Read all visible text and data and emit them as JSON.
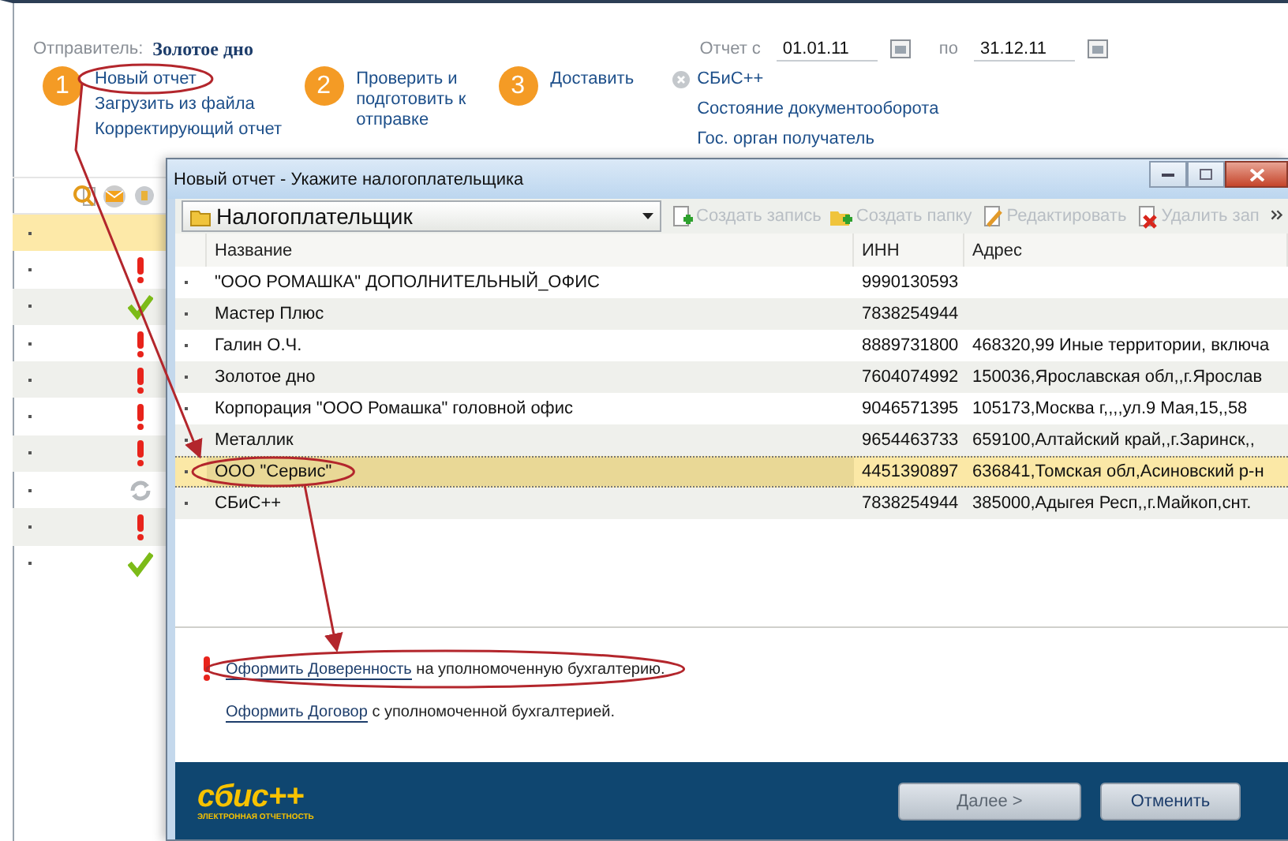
{
  "sender": {
    "label": "Отправитель:",
    "value": "Золотое дно"
  },
  "period": {
    "from_label": "Отчет с",
    "from": "01.01.11",
    "to_label": "по",
    "to": "31.12.11"
  },
  "steps": [
    {
      "number": "1",
      "links": [
        "Новый отчет",
        "Загрузить из файла",
        "Корректирующий отчет"
      ]
    },
    {
      "number": "2",
      "links": [
        "Проверить и подготовить к отправке"
      ]
    },
    {
      "number": "3",
      "links": [
        "Доставить"
      ]
    }
  ],
  "service": {
    "title": "СБиС++",
    "links": [
      "Состояние документооборота",
      "Гос. орган получатель"
    ]
  },
  "report_list": {
    "rows": [
      {
        "kind": "none",
        "selected": true
      },
      {
        "kind": "warning",
        "selected": false
      },
      {
        "kind": "ok",
        "selected": false
      },
      {
        "kind": "warning",
        "selected": false
      },
      {
        "kind": "warning",
        "selected": false
      },
      {
        "kind": "warning",
        "selected": false
      },
      {
        "kind": "warning",
        "selected": false
      },
      {
        "kind": "sync",
        "selected": false
      },
      {
        "kind": "warning",
        "selected": false
      },
      {
        "kind": "ok",
        "selected": false
      }
    ]
  },
  "dialog": {
    "title": "Новый отчет - Укажите налогоплательщика",
    "folder": "Налогоплательщик",
    "toolbar": [
      {
        "kind": "new",
        "label": "Создать запись",
        "disabled": true
      },
      {
        "kind": "folder",
        "label": "Создать папку",
        "disabled": true
      },
      {
        "kind": "edit",
        "label": "Редактировать",
        "disabled": true
      },
      {
        "kind": "delete",
        "label": "Удалить зап",
        "disabled": true
      }
    ],
    "columns": [
      "Название",
      "ИНН",
      "Адрес"
    ],
    "rows": [
      {
        "name": "\"ООО РОМАШКА\" ДОПОЛНИТЕЛЬНЫЙ_ОФИС",
        "inn": "9990130593",
        "selected": false
      },
      {
        "name": "Мастер Плюс",
        "inn": "7838254944",
        "selected": false
      },
      {
        "name": "Галин О.Ч.",
        "inn": "8889731800",
        "address": "468320,99 Иные территории, включа",
        "selected": false
      },
      {
        "name": "Золотое дно",
        "inn": "7604074992",
        "address": "150036,Ярославская обл,,г.Ярослав",
        "selected": false
      },
      {
        "name": "Корпорация \"ООО Ромашка\" головной офис",
        "inn": "9046571395",
        "address": "105173,Москва г,,,,ул.9 Мая,15,,58",
        "selected": false
      },
      {
        "name": "Металлик",
        "inn": "9654463733",
        "address": "659100,Алтайский край,,г.Заринск,,",
        "selected": false
      },
      {
        "name": "ООО \"Сервис\"",
        "inn": "4451390897",
        "address": "636841,Томская обл,Асиновский р-н",
        "selected": true
      },
      {
        "name": "СБиС++",
        "inn": "7838254944",
        "address": "385000,Адыгея Респ,,г.Майкоп,снт.",
        "selected": false
      }
    ],
    "notes": [
      {
        "link": "Оформить Доверенность",
        "rest": "на уполномоченную бухгалтерию.",
        "warning": true
      },
      {
        "link": "Оформить Договор",
        "rest": "с уполномоченной бухгалтерией.",
        "warning": false
      }
    ],
    "logo": {
      "text": "сбис++",
      "tagline": "ЭЛЕКТРОННАЯ ОТЧЕТНОСТЬ"
    },
    "buttons": [
      {
        "label": "Далее >",
        "disabled": true
      },
      {
        "label": "Отменить",
        "disabled": false
      }
    ]
  }
}
